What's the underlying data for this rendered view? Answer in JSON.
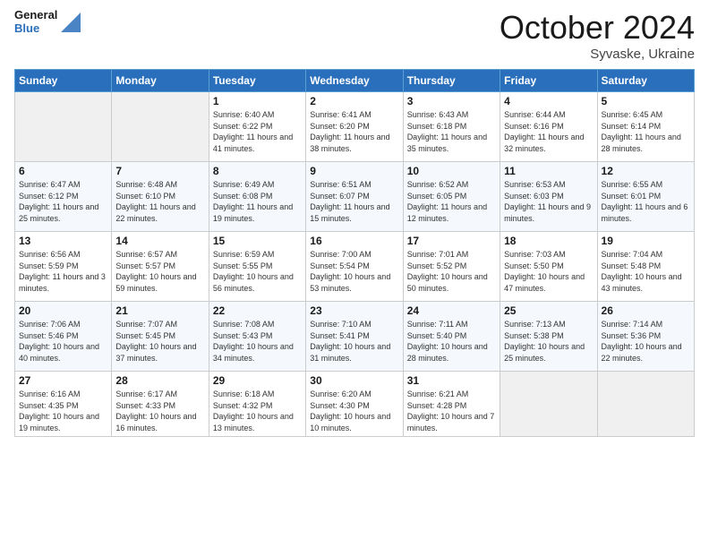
{
  "header": {
    "logo_line1": "General",
    "logo_line2": "Blue",
    "month": "October 2024",
    "location": "Syvaske, Ukraine"
  },
  "weekdays": [
    "Sunday",
    "Monday",
    "Tuesday",
    "Wednesday",
    "Thursday",
    "Friday",
    "Saturday"
  ],
  "weeks": [
    [
      {
        "day": "",
        "sunrise": "",
        "sunset": "",
        "daylight": ""
      },
      {
        "day": "",
        "sunrise": "",
        "sunset": "",
        "daylight": ""
      },
      {
        "day": "1",
        "sunrise": "Sunrise: 6:40 AM",
        "sunset": "Sunset: 6:22 PM",
        "daylight": "Daylight: 11 hours and 41 minutes."
      },
      {
        "day": "2",
        "sunrise": "Sunrise: 6:41 AM",
        "sunset": "Sunset: 6:20 PM",
        "daylight": "Daylight: 11 hours and 38 minutes."
      },
      {
        "day": "3",
        "sunrise": "Sunrise: 6:43 AM",
        "sunset": "Sunset: 6:18 PM",
        "daylight": "Daylight: 11 hours and 35 minutes."
      },
      {
        "day": "4",
        "sunrise": "Sunrise: 6:44 AM",
        "sunset": "Sunset: 6:16 PM",
        "daylight": "Daylight: 11 hours and 32 minutes."
      },
      {
        "day": "5",
        "sunrise": "Sunrise: 6:45 AM",
        "sunset": "Sunset: 6:14 PM",
        "daylight": "Daylight: 11 hours and 28 minutes."
      }
    ],
    [
      {
        "day": "6",
        "sunrise": "Sunrise: 6:47 AM",
        "sunset": "Sunset: 6:12 PM",
        "daylight": "Daylight: 11 hours and 25 minutes."
      },
      {
        "day": "7",
        "sunrise": "Sunrise: 6:48 AM",
        "sunset": "Sunset: 6:10 PM",
        "daylight": "Daylight: 11 hours and 22 minutes."
      },
      {
        "day": "8",
        "sunrise": "Sunrise: 6:49 AM",
        "sunset": "Sunset: 6:08 PM",
        "daylight": "Daylight: 11 hours and 19 minutes."
      },
      {
        "day": "9",
        "sunrise": "Sunrise: 6:51 AM",
        "sunset": "Sunset: 6:07 PM",
        "daylight": "Daylight: 11 hours and 15 minutes."
      },
      {
        "day": "10",
        "sunrise": "Sunrise: 6:52 AM",
        "sunset": "Sunset: 6:05 PM",
        "daylight": "Daylight: 11 hours and 12 minutes."
      },
      {
        "day": "11",
        "sunrise": "Sunrise: 6:53 AM",
        "sunset": "Sunset: 6:03 PM",
        "daylight": "Daylight: 11 hours and 9 minutes."
      },
      {
        "day": "12",
        "sunrise": "Sunrise: 6:55 AM",
        "sunset": "Sunset: 6:01 PM",
        "daylight": "Daylight: 11 hours and 6 minutes."
      }
    ],
    [
      {
        "day": "13",
        "sunrise": "Sunrise: 6:56 AM",
        "sunset": "Sunset: 5:59 PM",
        "daylight": "Daylight: 11 hours and 3 minutes."
      },
      {
        "day": "14",
        "sunrise": "Sunrise: 6:57 AM",
        "sunset": "Sunset: 5:57 PM",
        "daylight": "Daylight: 10 hours and 59 minutes."
      },
      {
        "day": "15",
        "sunrise": "Sunrise: 6:59 AM",
        "sunset": "Sunset: 5:55 PM",
        "daylight": "Daylight: 10 hours and 56 minutes."
      },
      {
        "day": "16",
        "sunrise": "Sunrise: 7:00 AM",
        "sunset": "Sunset: 5:54 PM",
        "daylight": "Daylight: 10 hours and 53 minutes."
      },
      {
        "day": "17",
        "sunrise": "Sunrise: 7:01 AM",
        "sunset": "Sunset: 5:52 PM",
        "daylight": "Daylight: 10 hours and 50 minutes."
      },
      {
        "day": "18",
        "sunrise": "Sunrise: 7:03 AM",
        "sunset": "Sunset: 5:50 PM",
        "daylight": "Daylight: 10 hours and 47 minutes."
      },
      {
        "day": "19",
        "sunrise": "Sunrise: 7:04 AM",
        "sunset": "Sunset: 5:48 PM",
        "daylight": "Daylight: 10 hours and 43 minutes."
      }
    ],
    [
      {
        "day": "20",
        "sunrise": "Sunrise: 7:06 AM",
        "sunset": "Sunset: 5:46 PM",
        "daylight": "Daylight: 10 hours and 40 minutes."
      },
      {
        "day": "21",
        "sunrise": "Sunrise: 7:07 AM",
        "sunset": "Sunset: 5:45 PM",
        "daylight": "Daylight: 10 hours and 37 minutes."
      },
      {
        "day": "22",
        "sunrise": "Sunrise: 7:08 AM",
        "sunset": "Sunset: 5:43 PM",
        "daylight": "Daylight: 10 hours and 34 minutes."
      },
      {
        "day": "23",
        "sunrise": "Sunrise: 7:10 AM",
        "sunset": "Sunset: 5:41 PM",
        "daylight": "Daylight: 10 hours and 31 minutes."
      },
      {
        "day": "24",
        "sunrise": "Sunrise: 7:11 AM",
        "sunset": "Sunset: 5:40 PM",
        "daylight": "Daylight: 10 hours and 28 minutes."
      },
      {
        "day": "25",
        "sunrise": "Sunrise: 7:13 AM",
        "sunset": "Sunset: 5:38 PM",
        "daylight": "Daylight: 10 hours and 25 minutes."
      },
      {
        "day": "26",
        "sunrise": "Sunrise: 7:14 AM",
        "sunset": "Sunset: 5:36 PM",
        "daylight": "Daylight: 10 hours and 22 minutes."
      }
    ],
    [
      {
        "day": "27",
        "sunrise": "Sunrise: 6:16 AM",
        "sunset": "Sunset: 4:35 PM",
        "daylight": "Daylight: 10 hours and 19 minutes."
      },
      {
        "day": "28",
        "sunrise": "Sunrise: 6:17 AM",
        "sunset": "Sunset: 4:33 PM",
        "daylight": "Daylight: 10 hours and 16 minutes."
      },
      {
        "day": "29",
        "sunrise": "Sunrise: 6:18 AM",
        "sunset": "Sunset: 4:32 PM",
        "daylight": "Daylight: 10 hours and 13 minutes."
      },
      {
        "day": "30",
        "sunrise": "Sunrise: 6:20 AM",
        "sunset": "Sunset: 4:30 PM",
        "daylight": "Daylight: 10 hours and 10 minutes."
      },
      {
        "day": "31",
        "sunrise": "Sunrise: 6:21 AM",
        "sunset": "Sunset: 4:28 PM",
        "daylight": "Daylight: 10 hours and 7 minutes."
      },
      {
        "day": "",
        "sunrise": "",
        "sunset": "",
        "daylight": ""
      },
      {
        "day": "",
        "sunrise": "",
        "sunset": "",
        "daylight": ""
      }
    ]
  ]
}
